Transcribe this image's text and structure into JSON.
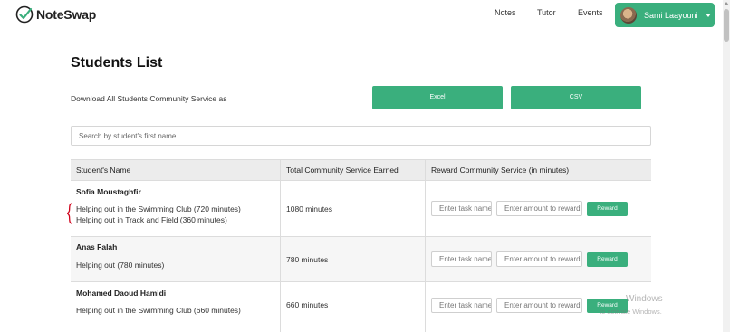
{
  "navbar": {
    "brand": "NoteSwap",
    "links": [
      "Notes",
      "Tutor",
      "Events"
    ],
    "user_name": "Sami Laayouni"
  },
  "page": {
    "title": "Students List",
    "download_label": "Download All Students Community Service as",
    "excel_label": "Excel",
    "csv_label": "CSV",
    "search_placeholder": "Search by student's first name"
  },
  "table": {
    "headers": [
      "Student's Name",
      "Total Community Service Earned",
      "Reward Community Service (in minutes)"
    ],
    "task_placeholder": "Enter task name",
    "amount_placeholder": "Enter amount to reward",
    "reward_label": "Reward",
    "rows": [
      {
        "name": "Sofia Moustaghfir",
        "tasks": [
          "Helping out in the Swimming Club (720 minutes)",
          "Helping out in Track and Field (360 minutes)"
        ],
        "total": "1080 minutes"
      },
      {
        "name": "Anas Falah",
        "tasks": [
          "Helping out (780 minutes)"
        ],
        "total": "780 minutes"
      },
      {
        "name": "Mohamed Daoud Hamidi",
        "tasks": [
          "Helping out in the Swimming Club (660 minutes)"
        ],
        "total": "660 minutes"
      }
    ]
  },
  "watermark": {
    "line1": "Windows",
    "line2": "to activate Windows."
  },
  "colors": {
    "accent": "#3aaf7d",
    "header_bg": "#ececec",
    "annotation_red": "#d0021b"
  }
}
